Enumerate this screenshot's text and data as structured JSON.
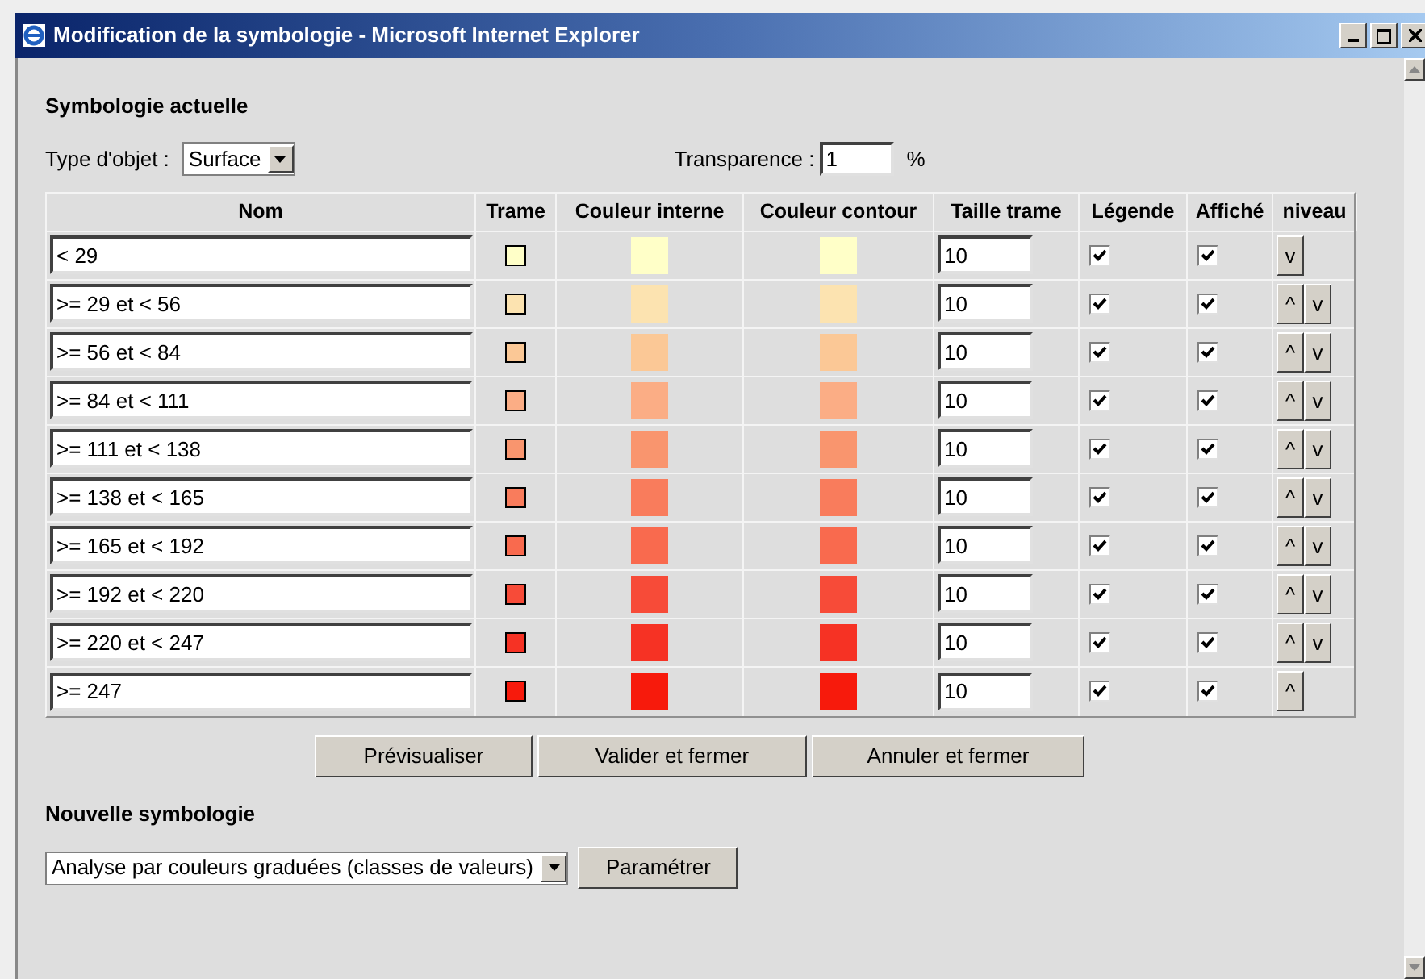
{
  "window": {
    "title": "Modification de la symbologie - Microsoft Internet Explorer"
  },
  "current": {
    "heading": "Symbologie actuelle",
    "object_type_label": "Type d'objet :",
    "object_type": "Surface",
    "transparency_label": "Transparence :",
    "transparency": "1",
    "transparency_unit": "%"
  },
  "table": {
    "columns": [
      "Nom",
      "Trame",
      "Couleur interne",
      "Couleur contour",
      "Taille trame",
      "Légende",
      "Affiché",
      "niveau"
    ],
    "rows": [
      {
        "name": "< 29",
        "color": "#ffffc8",
        "size": "10",
        "legend": true,
        "shown": true,
        "level_buttons": [
          "v"
        ]
      },
      {
        "name": ">= 29 et < 56",
        "color": "#fce3b0",
        "size": "10",
        "legend": true,
        "shown": true,
        "level_buttons": [
          "^",
          "v"
        ]
      },
      {
        "name": ">= 56 et < 84",
        "color": "#fbc896",
        "size": "10",
        "legend": true,
        "shown": true,
        "level_buttons": [
          "^",
          "v"
        ]
      },
      {
        "name": ">= 84 et < 111",
        "color": "#fbad85",
        "size": "10",
        "legend": true,
        "shown": true,
        "level_buttons": [
          "^",
          "v"
        ]
      },
      {
        "name": ">= 111 et < 138",
        "color": "#f9956e",
        "size": "10",
        "legend": true,
        "shown": true,
        "level_buttons": [
          "^",
          "v"
        ]
      },
      {
        "name": ">= 138 et < 165",
        "color": "#f97c5c",
        "size": "10",
        "legend": true,
        "shown": true,
        "level_buttons": [
          "^",
          "v"
        ]
      },
      {
        "name": ">= 165 et < 192",
        "color": "#f96a4e",
        "size": "10",
        "legend": true,
        "shown": true,
        "level_buttons": [
          "^",
          "v"
        ]
      },
      {
        "name": ">= 192 et < 220",
        "color": "#f74b38",
        "size": "10",
        "legend": true,
        "shown": true,
        "level_buttons": [
          "^",
          "v"
        ]
      },
      {
        "name": ">= 220 et < 247",
        "color": "#f63224",
        "size": "10",
        "legend": true,
        "shown": true,
        "level_buttons": [
          "^",
          "v"
        ]
      },
      {
        "name": ">= 247",
        "color": "#f71a0c",
        "size": "10",
        "legend": true,
        "shown": true,
        "level_buttons": [
          "^"
        ]
      }
    ]
  },
  "buttons": [
    "Prévisualiser",
    "Valider et fermer",
    "Annuler et fermer"
  ],
  "new": {
    "heading": "Nouvelle symbologie",
    "analysis": "Analyse par couleurs graduées (classes de valeurs)",
    "configure_button": "Paramétrer"
  }
}
